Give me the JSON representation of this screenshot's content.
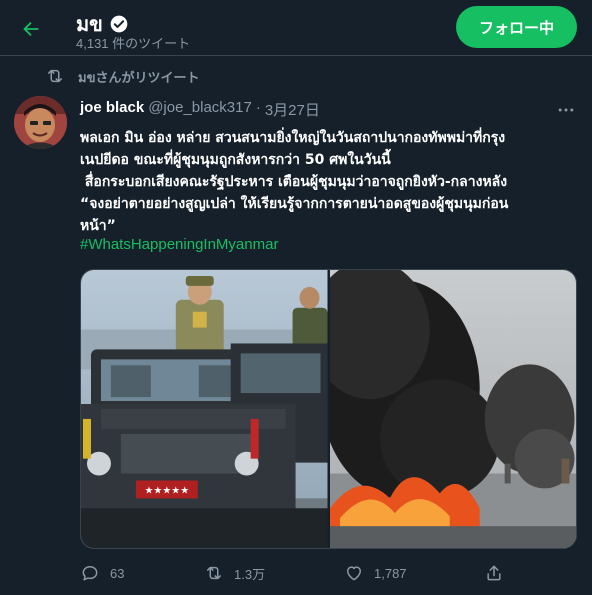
{
  "header": {
    "profile_name": "มข",
    "tweet_count": "4,131 件のツイート",
    "follow_label": "フォロー中"
  },
  "retweet": {
    "text": "มขさんがリツイート"
  },
  "tweet": {
    "author_name": "joe black",
    "author_handle": "@joe_black317",
    "separator": "·",
    "date": "3月27日",
    "lines": [
      "พลเอก มิน อ่อง หล่าย สวนสนามยิ่งใหญ่ในวันสถาปนากองทัพพม่าที่กรุง",
      "เนปยีดอ ขณะที่ผู้ชุมนุมถูกสังหารกว่า 50 ศพในวันนี้",
      " สื่อกระบอกเสียงคณะรัฐประหาร เตือนผู้ชุมนุมว่าอาจถูกยิงหัว-กลางหลัง",
      "“จงอย่าตายอย่างสูญเปล่า ให้เรียนรู้จากการตายน่าอดสูของผู้ชุมนุมก่อน",
      "หน้า”"
    ],
    "hashtag": "#WhatsHappeningInMyanmar",
    "plate_text": "★★★★★",
    "stats": {
      "replies": "63",
      "retweets": "1.3万",
      "likes": "1,787"
    }
  },
  "colors": {
    "background": "#15202b",
    "accent": "#17bf63",
    "muted": "#8b98a5",
    "divider": "#38444d"
  },
  "icons": [
    "back-arrow-icon",
    "verified-icon",
    "retweet-icon",
    "more-icon",
    "reply-icon",
    "like-icon",
    "share-icon"
  ]
}
